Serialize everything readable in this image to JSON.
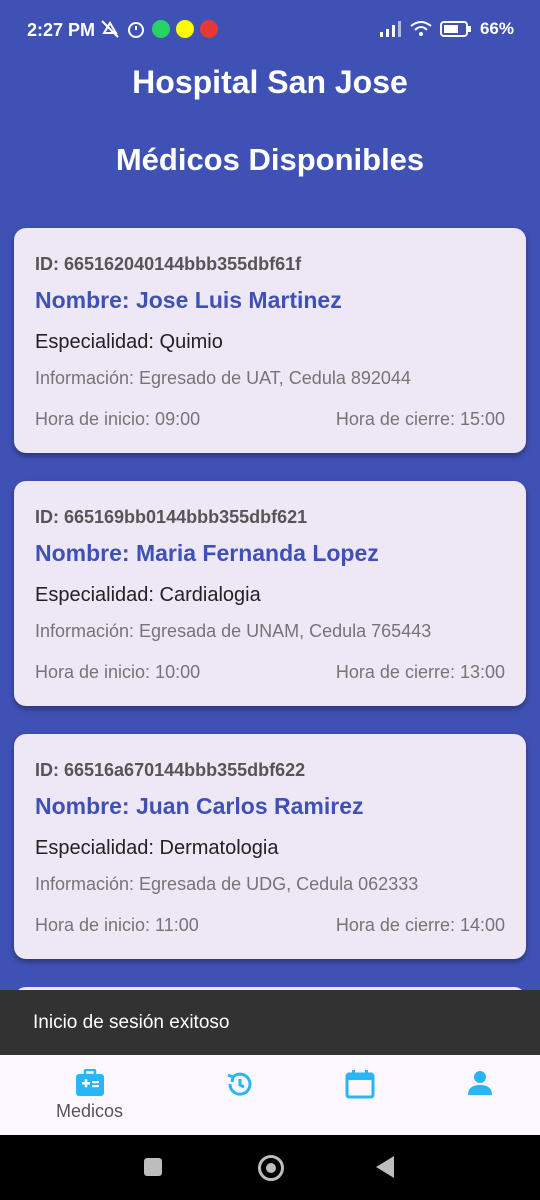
{
  "status_bar": {
    "time": "2:27 PM",
    "battery": "66%",
    "icons": [
      "mute-icon",
      "alarm-icon",
      "whatsapp-icon",
      "snapchat-icon",
      "app-icon",
      "signal-icon",
      "wifi-icon",
      "battery-icon"
    ]
  },
  "header": {
    "app_title": "Hospital San Jose",
    "page_title": "Médicos Disponibles"
  },
  "doctors": [
    {
      "id": "ID: 665162040144bbb355dbf61f",
      "name": "Nombre: Jose Luis Martinez",
      "specialty": "Especialidad: Quimio",
      "info": "Información: Egresado de UAT, Cedula 892044",
      "start": "Hora de inicio: 09:00",
      "end": "Hora de cierre: 15:00"
    },
    {
      "id": "ID: 665169bb0144bbb355dbf621",
      "name": "Nombre: Maria Fernanda Lopez",
      "specialty": "Especialidad: Cardialogia",
      "info": "Información: Egresada de UNAM, Cedula 765443",
      "start": "Hora de inicio: 10:00",
      "end": "Hora de cierre: 13:00"
    },
    {
      "id": "ID: 66516a670144bbb355dbf622",
      "name": "Nombre: Juan Carlos Ramirez",
      "specialty": "Especialidad: Dermatologia",
      "info": "Información: Egresada de UDG, Cedula 062333",
      "start": "Hora de inicio: 11:00",
      "end": "Hora de cierre: 14:00"
    }
  ],
  "snackbar": {
    "message": "Inicio de sesión exitoso"
  },
  "bottom_nav": {
    "items": [
      {
        "label": "Medicos",
        "icon": "medical-kit-icon",
        "active": true
      },
      {
        "label": "",
        "icon": "history-icon",
        "active": false
      },
      {
        "label": "",
        "icon": "calendar-icon",
        "active": false
      },
      {
        "label": "",
        "icon": "person-icon",
        "active": false
      }
    ],
    "accent": "#29b6f6"
  },
  "colors": {
    "background": "#3f51b5",
    "card": "#ede7f6",
    "name": "#3f51b5"
  }
}
